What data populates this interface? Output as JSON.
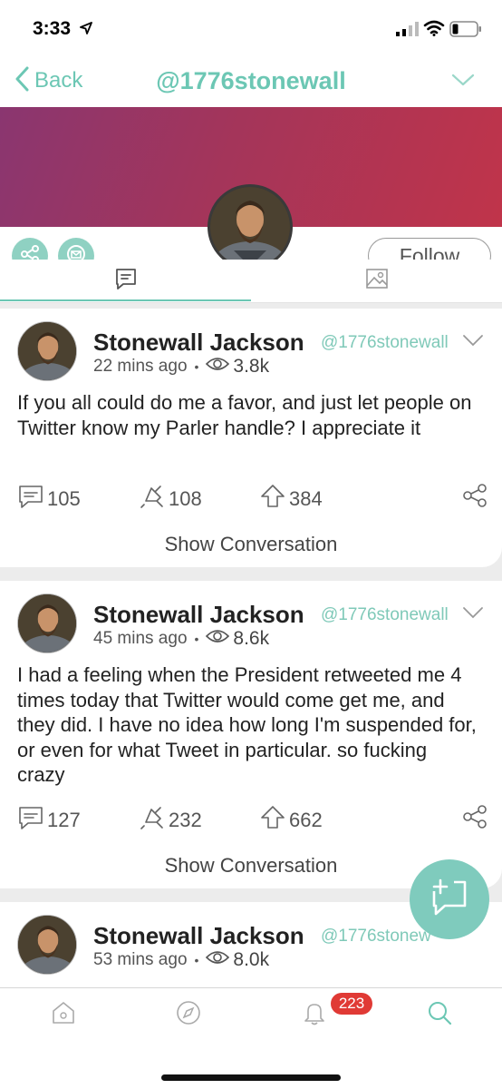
{
  "status_bar": {
    "time": "3:33"
  },
  "nav": {
    "back_label": "Back",
    "title": "@1776stonewall"
  },
  "profile": {
    "follow_label": "Follow"
  },
  "colors": {
    "accent": "#6cc7b4",
    "badge": "#e03a35",
    "banner_start": "#8a3670",
    "banner_end": "#c0344a"
  },
  "icons": [
    "location-arrow-icon",
    "signal-icon",
    "wifi-icon",
    "battery-icon",
    "chevron-left-icon",
    "chevron-down-icon",
    "share-icon",
    "mail-icon",
    "posts-tab-icon",
    "media-tab-icon",
    "comment-icon",
    "echo-icon",
    "upvote-icon",
    "compose-icon",
    "home-icon",
    "discover-icon",
    "bell-icon",
    "search-icon"
  ],
  "posts": [
    {
      "name": "Stonewall Jackson",
      "handle": "@1776stonewall",
      "time": "22 mins ago",
      "views": "3.8k",
      "text": "If you all could do me a favor, and just let people on Twitter know my Parler handle? I appreciate it",
      "comments": "105",
      "echoes": "108",
      "upvotes": "384",
      "show_conversation": "Show Conversation"
    },
    {
      "name": "Stonewall Jackson",
      "handle": "@1776stonewall",
      "time": "45 mins ago",
      "views": "8.6k",
      "text": "I had a feeling when the President retweeted me 4 times today that Twitter would come get me, and they did. I have no idea how long I'm suspended for, or even for what Tweet in particular. so fucking crazy",
      "comments": "127",
      "echoes": "232",
      "upvotes": "662",
      "show_conversation": "Show Conversation"
    },
    {
      "name": "Stonewall Jackson",
      "handle": "@1776stonew",
      "time": "53 mins ago",
      "views": "8.0k"
    }
  ],
  "bottom_nav": {
    "notification_count": "223"
  }
}
